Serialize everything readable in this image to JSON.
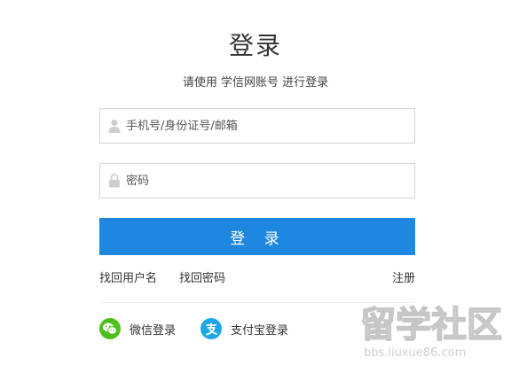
{
  "header": {
    "title": "登录",
    "subtitle": "请使用 学信网账号 进行登录"
  },
  "form": {
    "username_placeholder": "手机号/身份证号/邮箱",
    "username_icon": "user-icon",
    "password_placeholder": "密码",
    "password_icon": "lock-icon",
    "submit_label": "登 录"
  },
  "links": {
    "forgot_username": "找回用户名",
    "forgot_password": "找回密码",
    "register": "注册"
  },
  "social": {
    "wechat_label": "微信登录",
    "wechat_icon": "wechat-icon",
    "alipay_label": "支付宝登录",
    "alipay_icon": "alipay-icon"
  },
  "watermark": {
    "logo_text": "留学社区",
    "url_text": "bbs.liuxue86.com"
  },
  "colors": {
    "primary": "#1e88e0",
    "wechat": "#4cc01a",
    "alipay": "#1ea7e8",
    "input_border": "#d4d4d4",
    "text": "#333333",
    "watermark": "#c6c6c6"
  }
}
